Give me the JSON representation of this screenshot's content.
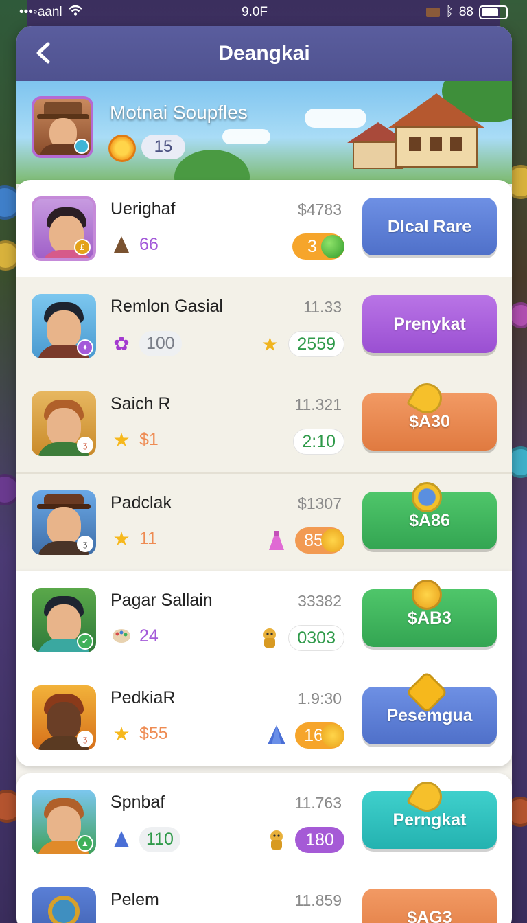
{
  "status_bar": {
    "carrier": "•••◦aanl",
    "time": "9.0F",
    "right_text": "88"
  },
  "nav": {
    "title": "Deangkai"
  },
  "profile": {
    "name": "Motnai Soupfles",
    "level": "15"
  },
  "colors": {
    "purple": "#a35ad9",
    "blue": "#5a7fd6",
    "orange": "#ee8b52",
    "green": "#3bb45a",
    "teal": "#2fc2c2",
    "chip_orange": "#f6a52b",
    "chip_purple": "#a55ad6"
  },
  "rows": [
    {
      "name": "Uerighaf",
      "stat_icon": "acorn-icon",
      "stat_value": "66",
      "price": "$4783",
      "chip": "3",
      "chip_icon": "green-orb-icon",
      "button": "Dlcal Rare",
      "button_color": "blue"
    },
    {
      "name": "Remlon Gasial",
      "stat_icon": "flower-icon",
      "stat_value": "100",
      "price": "11.33",
      "chip": "2559",
      "chip_icon": "star-burst-icon",
      "button": "Prenykat",
      "button_color": "purple"
    },
    {
      "name": "Saich R",
      "stat_icon": "star-icon",
      "stat_value": "$1",
      "price": "11.321",
      "chip": "2:10",
      "chip_icon": "",
      "button": "$A30",
      "button_color": "orange"
    },
    {
      "name": "Padclak",
      "stat_icon": "star-icon",
      "stat_value": "11",
      "price": "$1307",
      "chip": "85",
      "chip_icon": "potion-icon",
      "button": "$A86",
      "button_color": "green"
    },
    {
      "name": "Pagar Sallain",
      "stat_icon": "palette-icon",
      "stat_value": "24",
      "price": "33382",
      "chip": "0303",
      "chip_icon": "golem-icon",
      "button": "$AB3",
      "button_color": "green"
    },
    {
      "name": "PedkiaR",
      "stat_icon": "star-icon",
      "stat_value": "$55",
      "price": "1.9:30",
      "chip": "16",
      "chip_icon": "gem-icon",
      "button": "Pesemgua",
      "button_color": "blue"
    },
    {
      "name": "Spnbaf",
      "stat_icon": "gem-icon",
      "stat_value": "110",
      "price": "11.763",
      "chip": "180",
      "chip_icon": "golem-icon",
      "button": "Perngkat",
      "button_color": "teal"
    },
    {
      "name": "Pelem",
      "stat_icon": "star-icon",
      "stat_value": "",
      "price": "11.859",
      "chip": "",
      "chip_icon": "",
      "button": "$AG3",
      "button_color": "orange"
    }
  ]
}
